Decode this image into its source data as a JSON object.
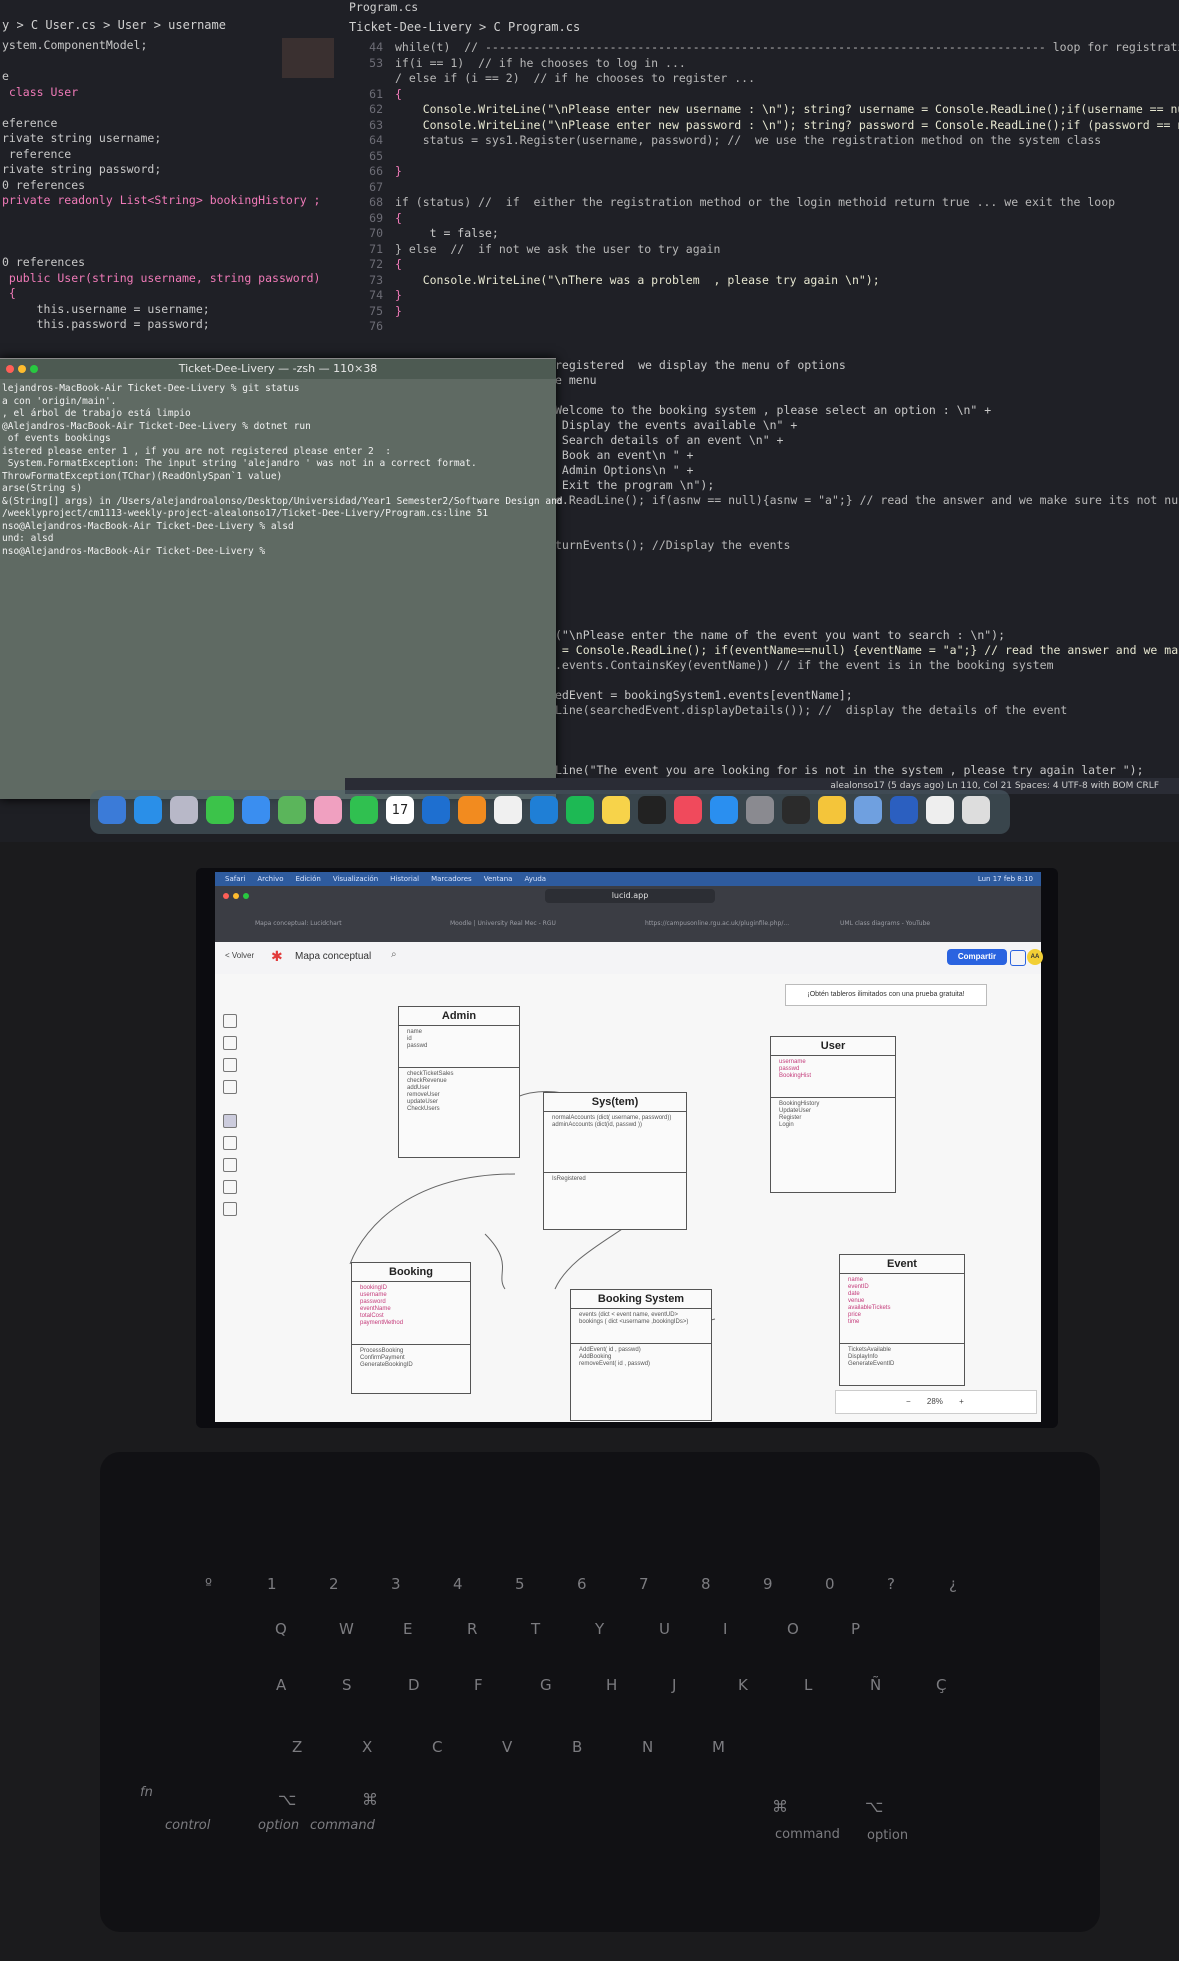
{
  "editor_left": {
    "breadcrumb": "y > C User.cs > User > username",
    "lines": [
      "ystem.ComponentModel;",
      "",
      "e",
      " class User",
      "",
      "eference",
      "rivate string username;",
      " reference",
      "rivate string password;",
      "0 references",
      "private readonly List<String> bookingHistory ;",
      "",
      "",
      "",
      "0 references",
      " public User(string username, string password)",
      " {",
      "     this.username = username;",
      "     this.password = password;"
    ]
  },
  "editor_right": {
    "breadcrumb": "Ticket-Dee-Livery > C Program.cs",
    "tab_title": "Program.cs",
    "line_numbers": [
      "44",
      "53",
      "",
      "61",
      "62",
      "63",
      "64",
      "65",
      "66",
      "67",
      "68",
      "69",
      "70",
      "71",
      "72",
      "73",
      "74",
      "75",
      "76"
    ],
    "lines": [
      "while(t)  // --------------------------------------------------------------------------------- loop for registration",
      "if(i == 1)  // if he chooses to log in ...",
      "/ else if (i == 2)  // if he chooses to register ...",
      "{",
      "    Console.WriteLine(\"\\nPlease enter new username : \\n\"); string? username = Console.ReadLine();if(username == null) {usern",
      "    Console.WriteLine(\"\\nPlease enter new password : \\n\"); string? password = Console.ReadLine();if (password == null) {passw",
      "    status = sys1.Register(username, password); //  we use the registration method on the system class",
      "",
      "}",
      "",
      "if (status) //  if  either the registration method or the login methoid return true ... we exit the loop",
      "{",
      "     t = false;",
      "} else  //  if not we ask the user to try again",
      "{",
      "    Console.WriteLine(\"\\nThere was a problem  , please try again \\n\");",
      "}",
      "}",
      ""
    ],
    "lower_lines": [
      "registered  we display the menu of options",
      "e menu",
      "",
      "Welcome to the booking system , please select an option : \\n\" +",
      " Display the events available \\n\" +",
      " Search details of an event \\n\" +",
      " Book an event\\n \" +",
      " Admin Options\\n \" +",
      " Exit the program \\n\");",
      "e.ReadLine(); if(asnw == null){asnw = \"a\";} // read the answer and we make sure its not null",
      "",
      "",
      "turnEvents(); //Display the events",
      "",
      "",
      "",
      "",
      "",
      "(\"\\nPlease enter the name of the event you want to search : \\n\");",
      " = Console.ReadLine(); if(eventName==null) {eventName = \"a\";} // read the answer and we make sure its not null",
      ".events.ContainsKey(eventName)) // if the event is in the booking system",
      "",
      "edEvent = bookingSystem1.events[eventName];",
      "Line(searchedEvent.displayDetails()); //  display the details of the event",
      "",
      "",
      "",
      "Line(\"The event you are looking for is not in the system , please try again later \");"
    ],
    "status_bar": "alealonso17 (5 days ago)   Ln 110, Col 21   Spaces: 4   UTF-8 with BOM   CRLF"
  },
  "terminal": {
    "title": "Ticket-Dee-Livery — -zsh — 110×38",
    "lines": [
      "lejandros-MacBook-Air Ticket-Dee-Livery % git status",
      "",
      "a con 'origin/main'.",
      "",
      ", el árbol de trabajo está limpio",
      "@Alejandros-MacBook-Air Ticket-Dee-Livery % dotnet run",
      "",
      " of events bookings",
      "",
      "istered please enter 1 , if you are not registered please enter 2  :",
      "",
      "",
      " System.FormatException: The input string 'alejandro ' was not in a correct format.",
      "ThrowFormatException(TChar)(ReadOnlySpan`1 value)",
      "arse(String s)",
      "&(String[] args) in /Users/alejandroalonso/Desktop/Universidad/Year1 Semester2/Software Design and",
      "/weeklyproject/cm1113-weekly-project-alealonso17/Ticket-Dee-Livery/Program.cs:line 51",
      "nso@Alejandros-MacBook-Air Ticket-Dee-Livery % alsd",
      "und: alsd",
      "nso@Alejandros-MacBook-Air Ticket-Dee-Livery % "
    ]
  },
  "dock": {
    "icons": [
      "finder-icon",
      "safari-icon",
      "launchpad-icon",
      "messages-icon",
      "mail-icon",
      "maps-icon",
      "photos-icon",
      "facetime-icon",
      "calendar-icon",
      "outlook-icon",
      "pages-icon",
      "reminders-icon",
      "vscode-icon",
      "spotify-icon",
      "notes-icon",
      "appletv-icon",
      "music-icon",
      "appstore-icon",
      "settings-icon",
      "terminal-icon",
      "keynote-icon",
      "preview-icon",
      "word-icon",
      "chatgpt-icon",
      "trash-icon"
    ],
    "calendar_day": "17",
    "colors": [
      "#3b7bd8",
      "#2a8fe8",
      "#b8b8c8",
      "#3cc34a",
      "#3a8ef0",
      "#5bb55b",
      "#f0a0c0",
      "#30c050",
      "#ffffff",
      "#1e6fd0",
      "#f28b1f",
      "#f0f0f0",
      "#1f7fd6",
      "#1db954",
      "#f7d34a",
      "#222222",
      "#f04a5c",
      "#2a8ff0",
      "#8a8a90",
      "#2b2b2b",
      "#f4c53a",
      "#6fa0e0",
      "#2b5fc0",
      "#eeeeee",
      "#dddddd"
    ]
  },
  "browser": {
    "mac_menu": [
      "Safari",
      "Archivo",
      "Edición",
      "Visualización",
      "Historial",
      "Marcadores",
      "Ventana",
      "Ayuda"
    ],
    "clock": "Lun 17 feb 8:10",
    "url": "lucid.app",
    "tabs": [
      "Mapa conceptual: Lucidchart",
      "Moodle | University Real Mec - RGU",
      "https://campusonline.rgu.ac.uk/pluginfile.php/...",
      "UML class diagrams - YouTube"
    ]
  },
  "lucid": {
    "back_label": "< Volver",
    "doc_title": "Mapa conceptual",
    "share_label": "Compartir",
    "avatar": "AA",
    "promo": "¡Obtén tableros ilimitados con una prueba gratuita!",
    "zoom": "28%",
    "classes": [
      {
        "title": "Admin",
        "fields": [
          "name",
          "id",
          "passwd"
        ],
        "methods": [
          "checkTicketSales",
          "checkRevenue",
          "addUser",
          "removeUser",
          "updateUser",
          "CheckUsers"
        ]
      },
      {
        "title": "User",
        "fields": [
          "username",
          "passwd",
          "BookingHist"
        ],
        "methods": [
          "BookingHistory",
          "UpdateUser",
          "Register",
          "Login"
        ]
      },
      {
        "title": "Sys(tem)",
        "fields": [
          "normalAccounts (dict( username, password))",
          "adminAccounts (dict(id, passwd ))"
        ],
        "methods": [
          "IsRegistered"
        ]
      },
      {
        "title": "Booking",
        "fields": [
          "bookingID",
          "username",
          "password",
          "eventName",
          "totalCost",
          "paymentMethod"
        ],
        "methods": [
          "ProcessBooking",
          "ConfirmPayment",
          "GenerateBookingID"
        ]
      },
      {
        "title": "Booking System",
        "fields": [
          "events (dict < event name, eventUD>",
          "bookings ( dict <username ,bookingIDs>)"
        ],
        "methods": [
          "AddEvent( id , passwd)",
          "AddBooking",
          "removeEvent( id , passwd)"
        ]
      },
      {
        "title": "Event",
        "fields": [
          "name",
          "eventID",
          "date",
          "venue",
          "availableTickets",
          "price",
          "time"
        ],
        "methods": [
          "TicketsAvailable",
          "DisplayInfo",
          "GenerateEventID"
        ]
      }
    ]
  },
  "keyboard": {
    "number_row": [
      "º",
      "1",
      "2",
      "3",
      "4",
      "5",
      "6",
      "7",
      "8",
      "9",
      "0",
      "?",
      "¿"
    ],
    "row1": [
      "Q",
      "W",
      "E",
      "R",
      "T",
      "Y",
      "U",
      "I",
      "O",
      "P"
    ],
    "row2": [
      "A",
      "S",
      "D",
      "F",
      "G",
      "H",
      "J",
      "K",
      "L",
      "Ñ",
      "Ç"
    ],
    "row3": [
      "Z",
      "X",
      "C",
      "V",
      "B",
      "N",
      "M"
    ],
    "modifiers_left": [
      "fn",
      "control",
      "option",
      "command"
    ],
    "modifiers_right": [
      "command",
      "option"
    ],
    "option_symbol": "⌥",
    "command_symbol": "⌘"
  }
}
